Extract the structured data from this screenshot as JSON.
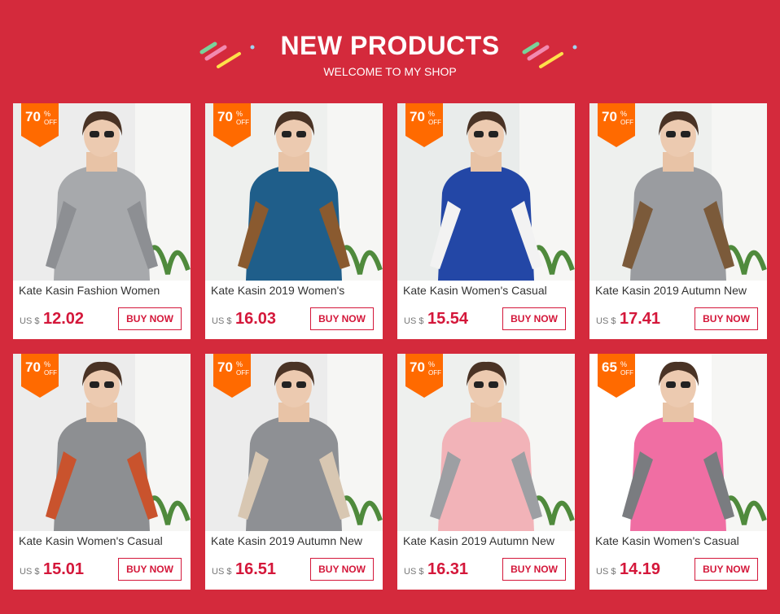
{
  "header": {
    "title": "NEW PRODUCTS",
    "subtitle": "WELCOME TO MY SHOP"
  },
  "colors": {
    "background": "#d42a3c",
    "accent": "#d4173a",
    "badge": "#ff6a00"
  },
  "products": [
    {
      "discount": "70",
      "pct": "%",
      "off": "OFF",
      "name": "Kate Kasin Fashion Women",
      "currency": "US $",
      "price": "12.02",
      "button": "BUY NOW",
      "garment": "#a7a9ac",
      "accentColor": "#8d8f93",
      "bg": "#ececec"
    },
    {
      "discount": "70",
      "pct": "%",
      "off": "OFF",
      "name": "Kate Kasin 2019 Women's",
      "currency": "US $",
      "price": "16.03",
      "button": "BUY NOW",
      "garment": "#1f5e8a",
      "accentColor": "#8a5a2f",
      "bg": "#eef0ee"
    },
    {
      "discount": "70",
      "pct": "%",
      "off": "OFF",
      "name": "Kate Kasin Women's Casual",
      "currency": "US $",
      "price": "15.54",
      "button": "BUY NOW",
      "garment": "#2347a6",
      "accentColor": "#f2f2f2",
      "bg": "#e9eceb"
    },
    {
      "discount": "70",
      "pct": "%",
      "off": "OFF",
      "name": "Kate Kasin 2019 Autumn New",
      "currency": "US $",
      "price": "17.41",
      "button": "BUY NOW",
      "garment": "#9a9ca0",
      "accentColor": "#7b5a3a",
      "bg": "#eef0ee"
    },
    {
      "discount": "70",
      "pct": "%",
      "off": "OFF",
      "name": "Kate Kasin Women's Casual",
      "currency": "US $",
      "price": "15.01",
      "button": "BUY NOW",
      "garment": "#8d8f92",
      "accentColor": "#c9532d",
      "bg": "#ececec"
    },
    {
      "discount": "70",
      "pct": "%",
      "off": "OFF",
      "name": "Kate Kasin 2019 Autumn New",
      "currency": "US $",
      "price": "16.51",
      "button": "BUY NOW",
      "garment": "#8e9094",
      "accentColor": "#d8c7b2",
      "bg": "#ececec"
    },
    {
      "discount": "70",
      "pct": "%",
      "off": "OFF",
      "name": "Kate Kasin 2019 Autumn New",
      "currency": "US $",
      "price": "16.31",
      "button": "BUY NOW",
      "garment": "#f2b3b8",
      "accentColor": "#9d9fa3",
      "bg": "#eef0ee"
    },
    {
      "discount": "65",
      "pct": "%",
      "off": "OFF",
      "name": "Kate Kasin Women's Casual",
      "currency": "US $",
      "price": "14.19",
      "button": "BUY NOW",
      "garment": "#f06ea3",
      "accentColor": "#7a7c80",
      "bg": "#ffffff"
    }
  ]
}
